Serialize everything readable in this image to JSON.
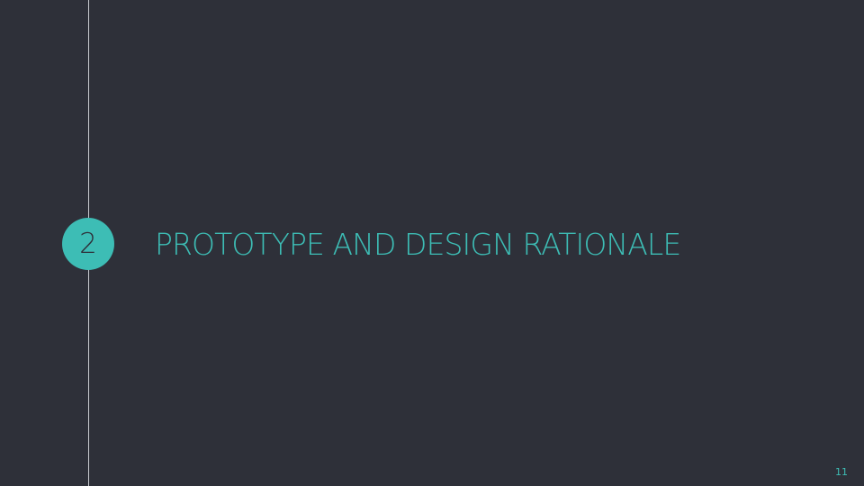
{
  "slide": {
    "section_number": "2",
    "section_title": "PROTOTYPE AND DESIGN RATIONALE",
    "page_number": "11"
  },
  "colors": {
    "background": "#2e3039",
    "accent": "#3dbdb5",
    "timeline": "#c9cbd0"
  }
}
